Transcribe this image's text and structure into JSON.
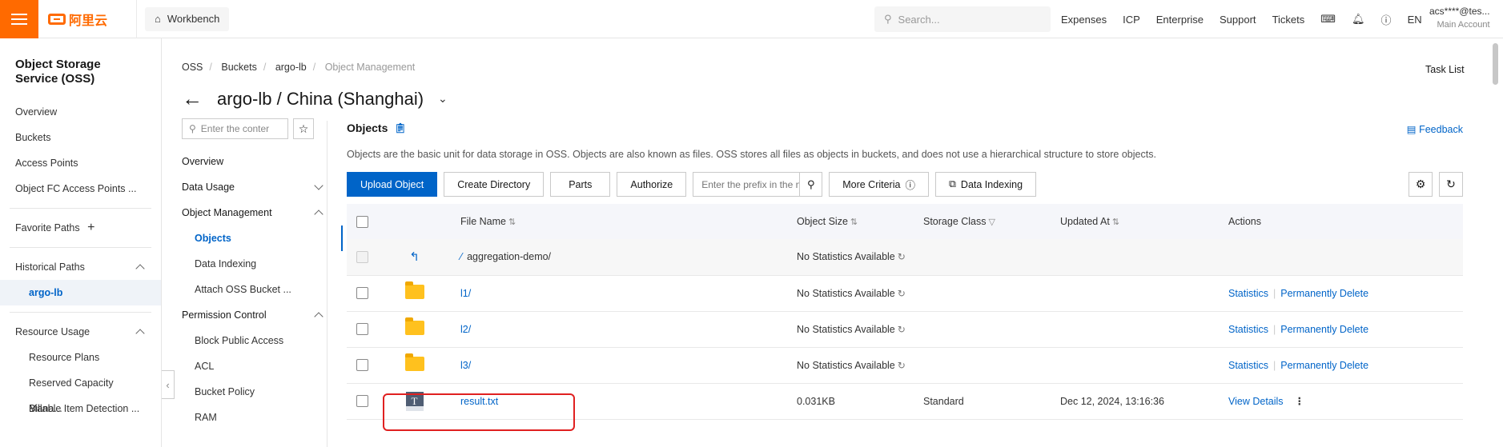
{
  "topbar": {
    "logo": "阿里云",
    "workbench": "Workbench",
    "search_placeholder": "Search...",
    "nav": [
      "Expenses",
      "ICP",
      "Enterprise",
      "Support",
      "Tickets"
    ],
    "lang": "EN",
    "account": "acs****@tes...",
    "account_sub": "Main Account"
  },
  "sidebar": {
    "title": "Object Storage Service (OSS)",
    "items": [
      "Overview",
      "Buckets",
      "Access Points",
      "Object FC Access Points ..."
    ],
    "favorite": "Favorite Paths",
    "historical": "Historical Paths",
    "historical_item": "argo-lb",
    "resource_usage": "Resource Usage",
    "resource_items": [
      "Resource Plans",
      "Reserved Capacity Mana...",
      "Billable Item Detection ..."
    ]
  },
  "breadcrumb": [
    "OSS",
    "Buckets",
    "argo-lb",
    "Object Management"
  ],
  "task_list": "Task List",
  "page_title": "argo-lb / China (Shanghai)",
  "inner_nav": {
    "search_placeholder": "Enter the conter",
    "overview": "Overview",
    "data_usage": "Data Usage",
    "object_mgmt": "Object Management",
    "objects": "Objects",
    "data_indexing": "Data Indexing",
    "attach": "Attach OSS Bucket ...",
    "permission": "Permission Control",
    "block_public": "Block Public Access",
    "acl": "ACL",
    "bucket_policy": "Bucket Policy",
    "ram": "RAM"
  },
  "objects": {
    "title": "Objects",
    "feedback": "Feedback",
    "description": "Objects are the basic unit for data storage in OSS. Objects are also known as files. OSS stores all files as objects in buckets, and does not use a hierarchical structure to store objects.",
    "buttons": {
      "upload": "Upload Object",
      "create_dir": "Create Directory",
      "parts": "Parts",
      "authorize": "Authorize",
      "prefix_placeholder": "Enter the prefix in the name",
      "more": "More Criteria",
      "indexing": "Data Indexing"
    },
    "columns": [
      "File Name",
      "Object Size",
      "Storage Class",
      "Updated At",
      "Actions"
    ],
    "parent_row": {
      "name": "aggregation-demo/",
      "size": "No Statistics Available"
    },
    "rows": [
      {
        "name": "l1/",
        "size": "No Statistics Available",
        "class": "",
        "updated": "",
        "act1": "Statistics",
        "act2": "Permanently Delete"
      },
      {
        "name": "l2/",
        "size": "No Statistics Available",
        "class": "",
        "updated": "",
        "act1": "Statistics",
        "act2": "Permanently Delete"
      },
      {
        "name": "l3/",
        "size": "No Statistics Available",
        "class": "",
        "updated": "",
        "act1": "Statistics",
        "act2": "Permanently Delete"
      },
      {
        "name": "result.txt",
        "size": "0.031KB",
        "class": "Standard",
        "updated": "Dec 12, 2024, 13:16:36",
        "act1": "View Details",
        "act2": ""
      }
    ]
  }
}
